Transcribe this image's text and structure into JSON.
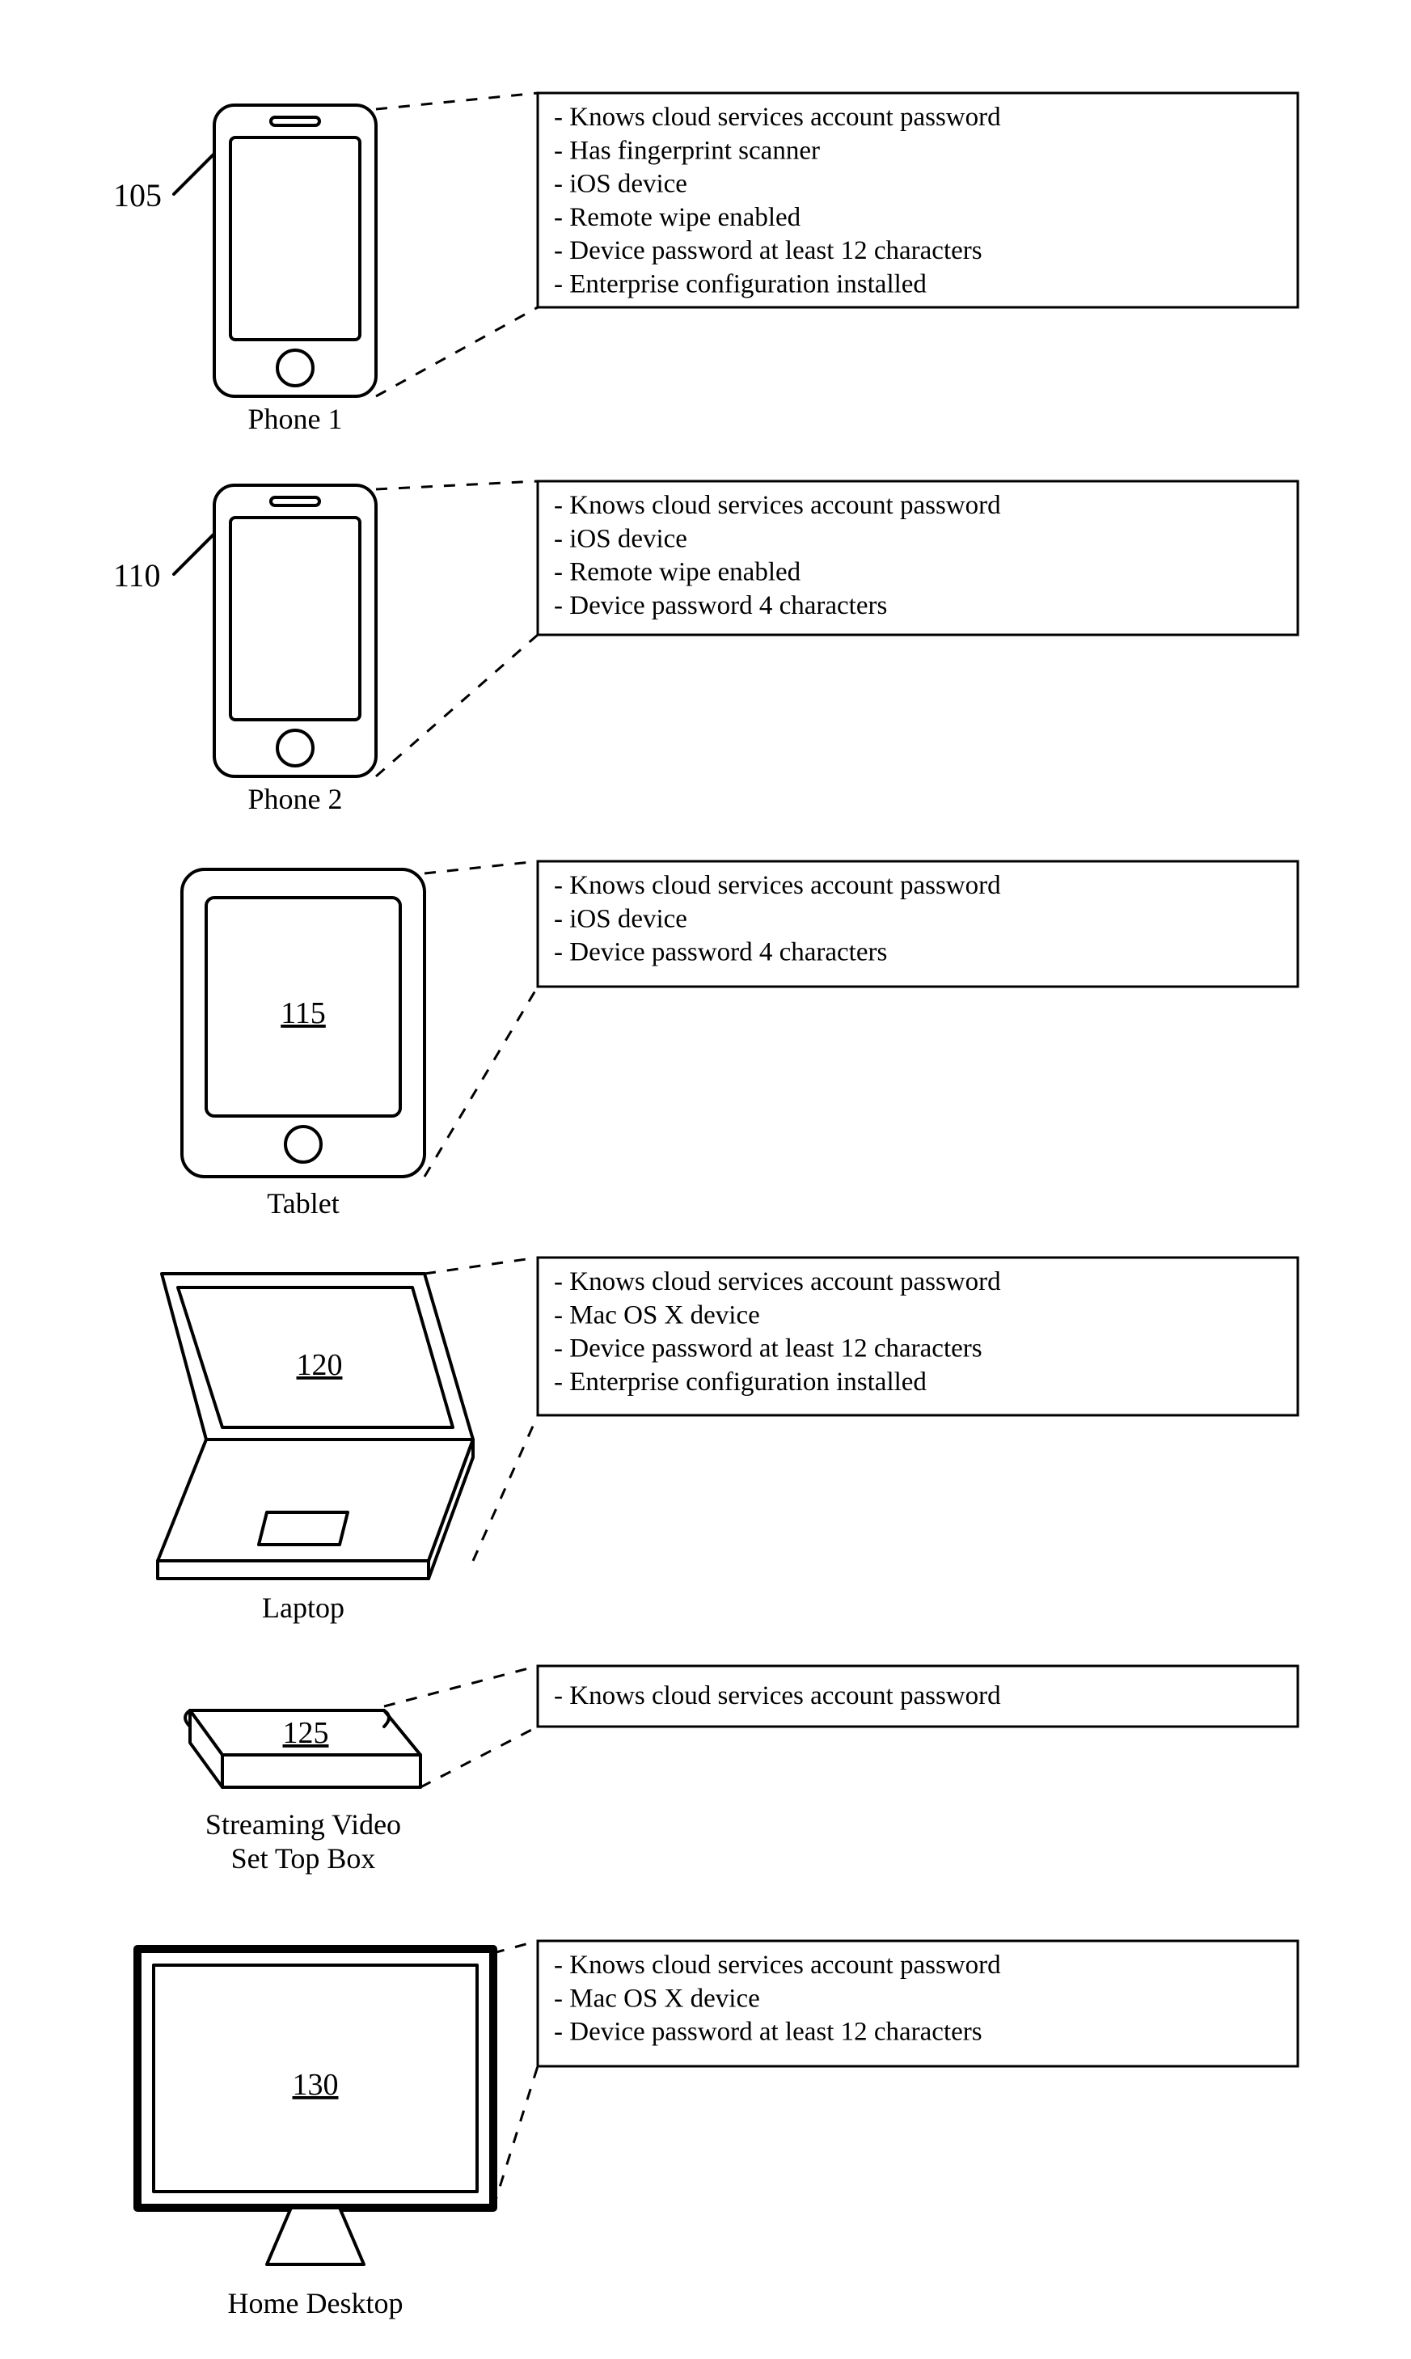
{
  "devices": [
    {
      "id": "phone1",
      "ref": "105",
      "caption": "Phone 1",
      "props": [
        "- Knows cloud services account password",
        "- Has fingerprint scanner",
        "- iOS device",
        "- Remote wipe enabled",
        "- Device password at least 12 characters",
        "- Enterprise configuration installed"
      ]
    },
    {
      "id": "phone2",
      "ref": "110",
      "caption": "Phone 2",
      "props": [
        "- Knows cloud services account password",
        "- iOS device",
        "- Remote wipe enabled",
        "- Device password 4 characters"
      ]
    },
    {
      "id": "tablet",
      "ref": "115",
      "caption": "Tablet",
      "props": [
        "- Knows cloud services account password",
        "- iOS device",
        "- Device password 4 characters"
      ]
    },
    {
      "id": "laptop",
      "ref": "120",
      "caption": "Laptop",
      "props": [
        "- Knows cloud services account password",
        "- Mac OS X device",
        "- Device password at least 12 characters",
        "- Enterprise configuration installed"
      ]
    },
    {
      "id": "settop",
      "ref": "125",
      "caption_line1": "Streaming Video",
      "caption_line2": "Set Top Box",
      "props": [
        "- Knows cloud services account password"
      ]
    },
    {
      "id": "desktop",
      "ref": "130",
      "caption": "Home Desktop",
      "props": [
        "- Knows cloud services account password",
        "- Mac OS X device",
        "- Device password at least 12 characters"
      ]
    }
  ]
}
